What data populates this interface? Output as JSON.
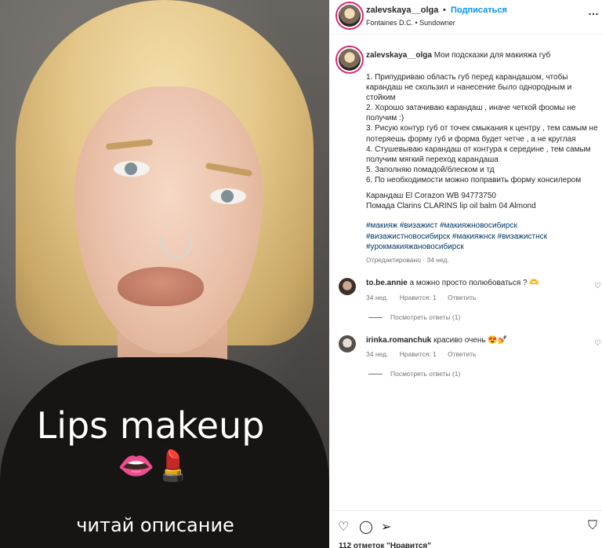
{
  "media": {
    "overlay_title": "Lips makeup",
    "overlay_emoji": "👄💄",
    "overlay_subtitle": "читай описание"
  },
  "header": {
    "username": "zalevskaya__olga",
    "separator": "•",
    "follow_label": "Подписаться",
    "music": "Fontaines D.C. • Sundowner",
    "more_icon": "…"
  },
  "caption": {
    "username": "zalevskaya__olga",
    "intro": "Мои подсказки для макияжа губ",
    "steps": [
      "1. Припудриваю область губ перед карандашом, чтобы",
      "карандаш не скользил и нанесение было однородным и",
      "стойким",
      "2. Хорошо затачиваю карандаш , иначе четкой фоомы не",
      "получим :)",
      "3. Рисую контур губ от точек смыкания к центру , тем самым не",
      "потеряешь форму губ и форма будет четче , а не круглая",
      "4. Стушевываю карандаш от контура к середине , тем самым",
      "получим мягкий переход карандаша",
      "5. Заполняю помадой/блеском и тд",
      "6. По необходимости можно поправить форму консилером"
    ],
    "products": [
      "Карандаш El Corazon WB 94773750",
      "Помада Clarins CLARINS lip oil balm 04 Almond"
    ],
    "hashtags": [
      "#макияж #визажист #макияжновосибирск",
      "#визажистновосибирск #макияжнск #визажистнск",
      "#урокмакияжановосибирск"
    ],
    "edited": "Отредактировано · 34 нед."
  },
  "comments": [
    {
      "username": "to.be.annie",
      "text": "а можно просто полюбоваться ? 🫶",
      "time": "34 нед.",
      "likes": "Нравится: 1",
      "reply": "Ответить",
      "view_replies": "Посмотреть ответы (1)"
    },
    {
      "username": "irinka.romanchuk",
      "text": "красиво очень 😍💅",
      "time": "34 нед.",
      "likes": "Нравится: 1",
      "reply": "Ответить",
      "view_replies": "Посмотреть ответы (1)"
    }
  ],
  "icons": {
    "heart": "♡",
    "comment": "◯",
    "share": "➢",
    "save": "⛉"
  },
  "likes_text": "112 отметок \"Нравится\"",
  "colors": {
    "link_blue": "#0095f6",
    "hashtag_blue": "#00376b",
    "muted": "#737373",
    "story_ring": "#d62976"
  }
}
